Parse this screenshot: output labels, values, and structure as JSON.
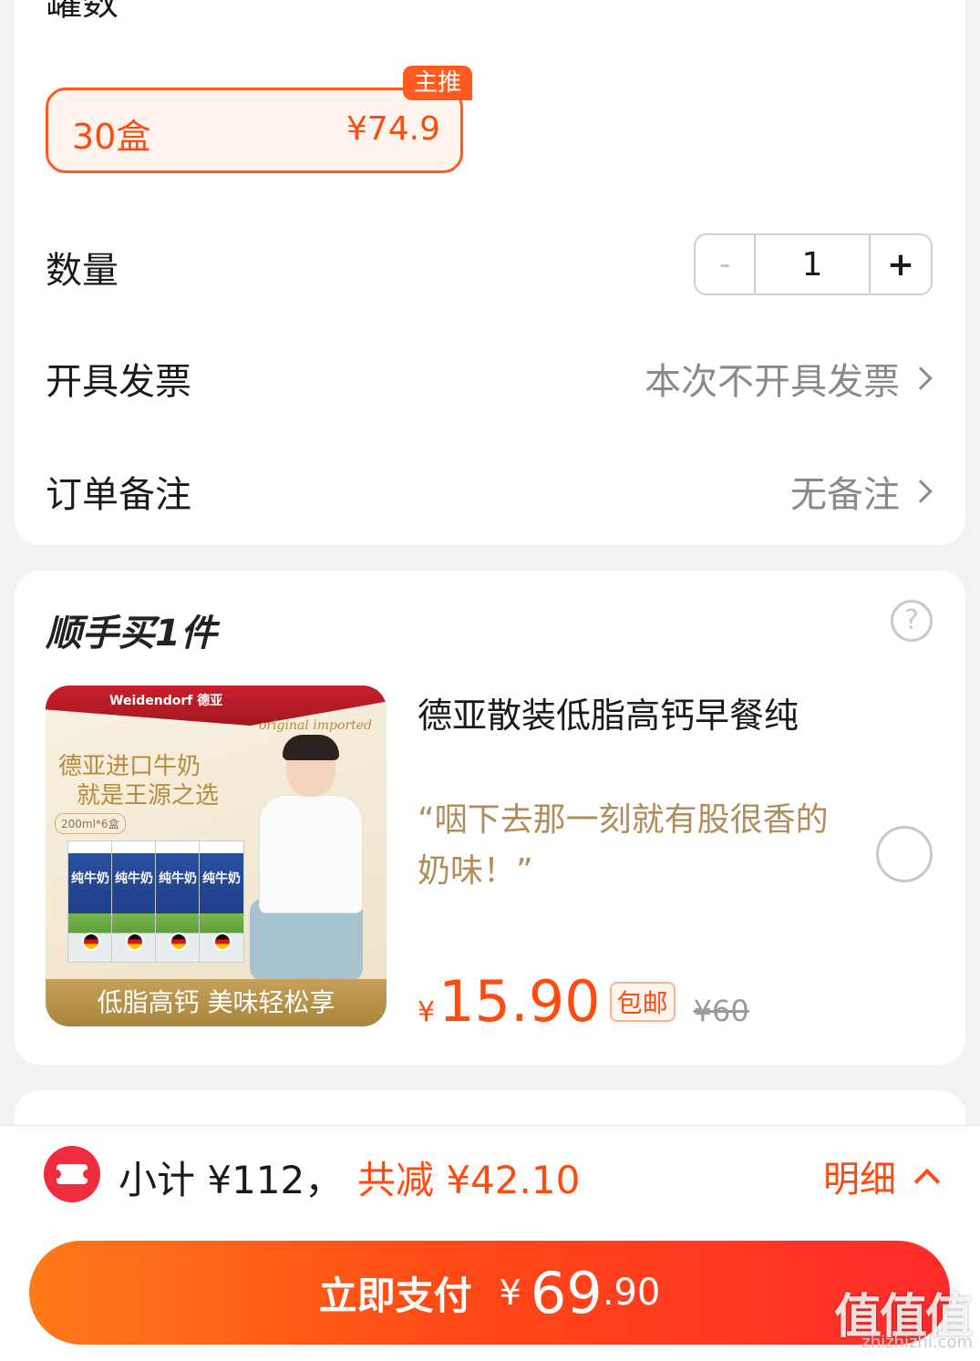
{
  "order": {
    "can_count_label": "罐数",
    "option": {
      "qty": "30盒",
      "price": "¥74.9",
      "tag": "主推"
    },
    "quantity_label": "数量",
    "stepper": {
      "minus": "-",
      "value": "1",
      "plus": "+"
    },
    "invoice": {
      "label": "开具发票",
      "value": "本次不开具发票"
    },
    "remark": {
      "label": "订单备注",
      "value": "无备注"
    }
  },
  "addon": {
    "title": "顺手买1件",
    "help_icon": "question-circle-icon",
    "product": {
      "image": {
        "brand": "Weidendorf 德亚",
        "original": "original imported",
        "slogan_line1": "德亚进口牛奶",
        "slogan_line2": "就是王源之选",
        "spec": "200ml*6盒",
        "box_label": "纯牛奶",
        "bottom_text": "低脂高钙 美味轻松享"
      },
      "name": "德亚散装低脂高钙早餐纯",
      "quote": "“咽下去那一刻就有股很香的奶味！”",
      "currency": "¥",
      "price": "15.90",
      "free_shipping": "包邮",
      "original_price": "¥60"
    }
  },
  "footer": {
    "coupon_icon": "coupon-ticket-icon",
    "subtotal": "小计 ¥112，",
    "discount": "共减 ¥42.10",
    "detail": "明细",
    "pay": {
      "label": "立即支付",
      "currency": "¥",
      "int": "69",
      "dec": ".90"
    }
  },
  "watermark": {
    "main": "值值值",
    "sub": "zhizhizhi.com"
  },
  "colors": {
    "accent": "#ff4a10",
    "coupon": "#ef2d3e",
    "quote": "#b08d5a"
  }
}
